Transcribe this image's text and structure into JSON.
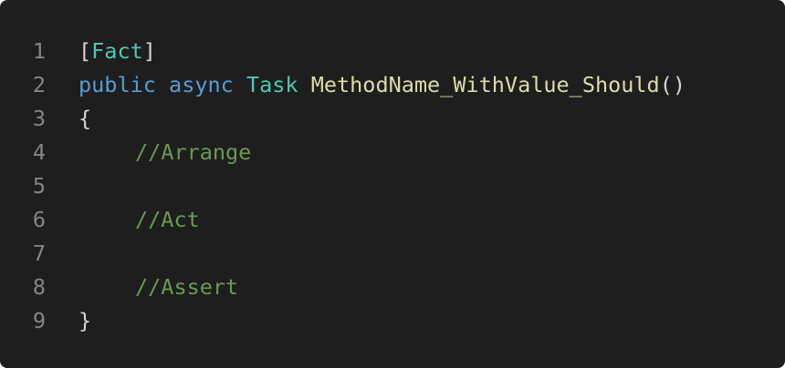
{
  "editor": {
    "line_numbers": [
      "1",
      "2",
      "3",
      "4",
      "5",
      "6",
      "7",
      "8",
      "9"
    ],
    "lines": {
      "l1": {
        "open_bracket": "[",
        "attribute": "Fact",
        "close_bracket": "]"
      },
      "l2": {
        "kw_public": "public",
        "kw_async": "async",
        "type_task": "Task",
        "method_name": "MethodName_WithValue_Should",
        "parens": "()"
      },
      "l3": {
        "brace": "{"
      },
      "l4": {
        "comment": "//Arrange"
      },
      "l6": {
        "comment": "//Act"
      },
      "l8": {
        "comment": "//Assert"
      },
      "l9": {
        "brace": "}"
      }
    },
    "colors": {
      "background": "#1e1e1e",
      "line_number": "#858585",
      "punctuation": "#d4d4d4",
      "type": "#4ec9b0",
      "keyword": "#569cd6",
      "method": "#dcdcaa",
      "comment": "#6a9955"
    }
  }
}
